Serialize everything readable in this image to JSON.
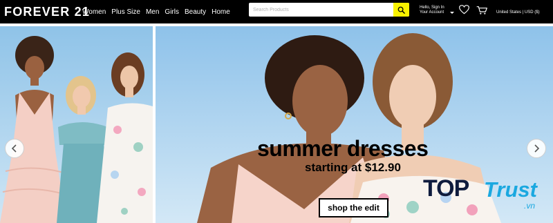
{
  "header": {
    "logo": "FOREVER 21",
    "nav": [
      "Women",
      "Plus Size",
      "Men",
      "Girls",
      "Beauty",
      "Home"
    ],
    "search": {
      "placeholder": "Search Products"
    },
    "account": {
      "line1": "Hello, Sign In",
      "line2": "Your Account"
    },
    "locale": "United States | USD ($)",
    "colors": {
      "background": "#000000",
      "search_button": "#f8f200"
    },
    "icons": [
      "search-icon",
      "heart-icon",
      "shopping-bag-icon",
      "chevron-down-icon"
    ]
  },
  "hero": {
    "headline": "summer dresses",
    "subline": "starting at $12.90",
    "cta": "shop the edit",
    "arrows": [
      "chevron-left-icon",
      "chevron-right-icon"
    ]
  },
  "watermark": {
    "part1": "TOP",
    "part2": "Trust",
    "part3": ".vn"
  }
}
